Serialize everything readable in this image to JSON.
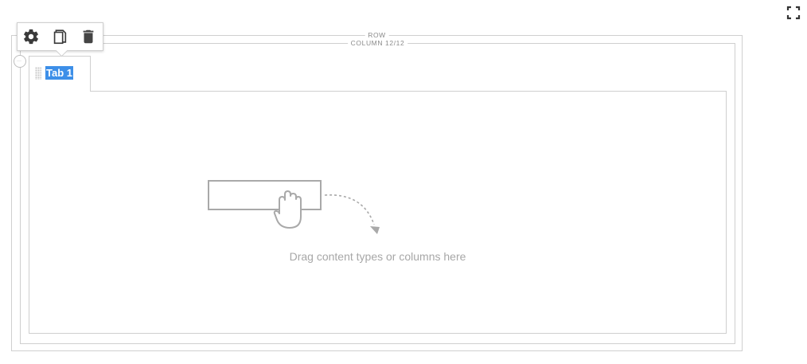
{
  "row": {
    "label": "ROW"
  },
  "column": {
    "label": "COLUMN 12/12"
  },
  "tabs": [
    {
      "title": "Tab 1"
    }
  ],
  "toolbar": {
    "icons": [
      "gear-icon",
      "duplicate-icon",
      "trash-icon"
    ]
  },
  "empty_state": {
    "text": "Drag content types or columns here"
  },
  "colors": {
    "border": "#cfcfcf",
    "tab_highlight": "#3d8fe8",
    "icon": "#444444",
    "muted_text": "#a7a7a7"
  }
}
